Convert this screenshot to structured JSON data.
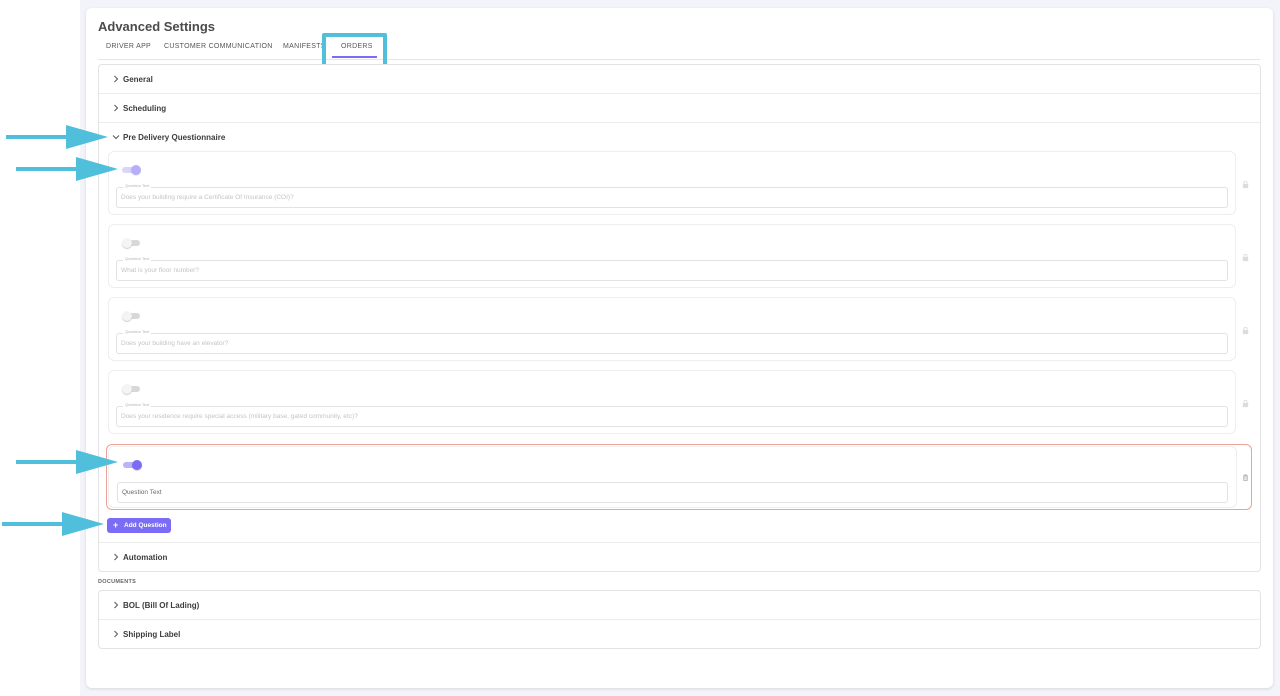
{
  "page": {
    "title": "Advanced Settings"
  },
  "tabs": [
    {
      "label": "DRIVER APP"
    },
    {
      "label": "CUSTOMER COMMUNICATION"
    },
    {
      "label": "MANIFESTS"
    },
    {
      "label": "ORDERS"
    }
  ],
  "accordion": {
    "general": "General",
    "scheduling": "Scheduling",
    "pre_delivery": "Pre Delivery Questionnaire",
    "automation": "Automation"
  },
  "questions": [
    {
      "label": "Question Text",
      "value": "Does your building require a Certificate Of Insurance (COI)?",
      "enabled": true,
      "icon": "lock-icon"
    },
    {
      "label": "Question Text",
      "value": "What is your floor number?",
      "enabled": false,
      "icon": "lock-icon"
    },
    {
      "label": "Question Text",
      "value": "Does your building have an elevator?",
      "enabled": false,
      "icon": "lock-icon"
    },
    {
      "label": "Question Text",
      "value": "Does your residence require special access (military base, gated community, etc)?",
      "enabled": false,
      "icon": "lock-icon"
    },
    {
      "label": "",
      "value": "Question Text",
      "enabled": true,
      "icon": "trash-icon"
    }
  ],
  "add_question": {
    "label": "Add Question"
  },
  "documents": {
    "heading": "DOCUMENTS",
    "items": [
      {
        "label": "BOL (Bill Of Lading)"
      },
      {
        "label": "Shipping Label"
      }
    ]
  },
  "colors": {
    "accent": "#7b6cf6",
    "annotation": "#4fbfdc",
    "active_border": "#e9a39a"
  }
}
